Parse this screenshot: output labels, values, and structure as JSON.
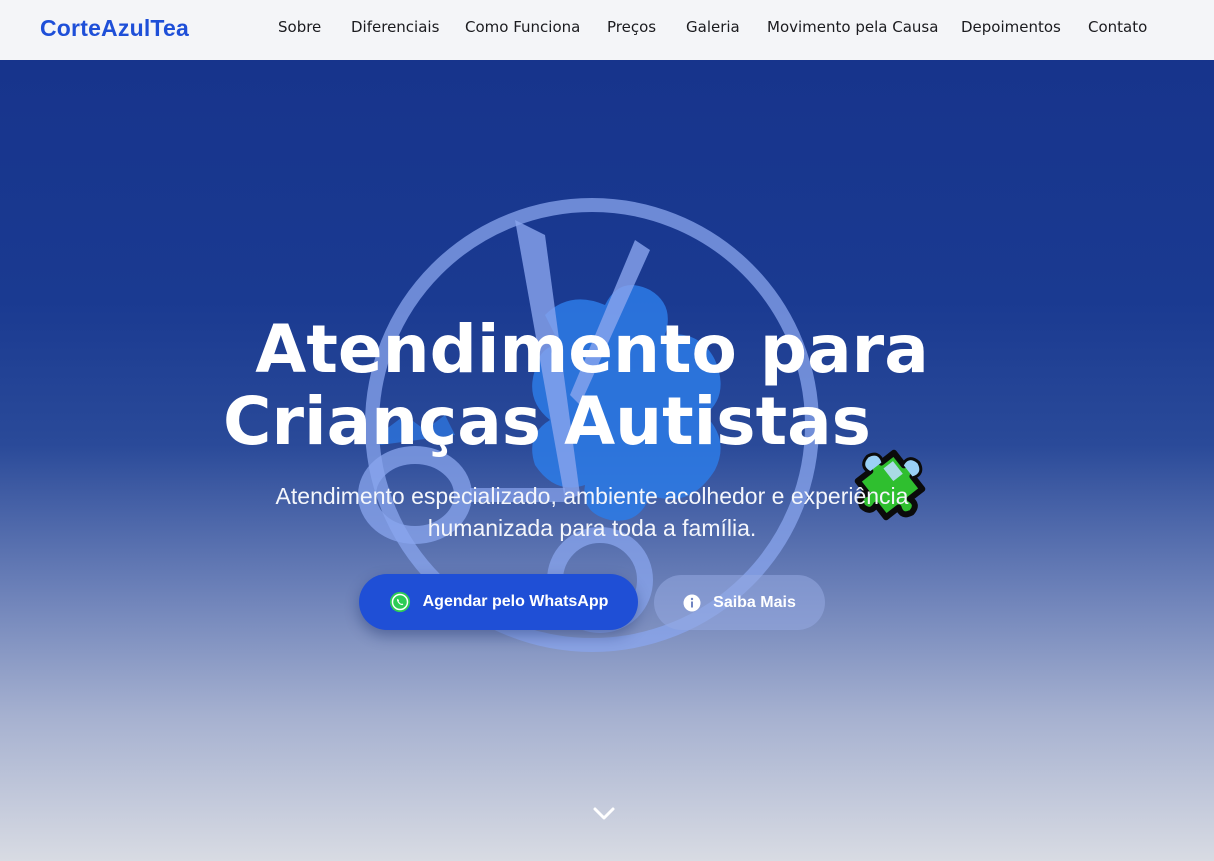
{
  "brand": {
    "name": "CorteAzulTea",
    "color": "#1e4fd8"
  },
  "nav": {
    "items": [
      {
        "label": "Sobre"
      },
      {
        "label": "Diferenciais"
      },
      {
        "label": "Como Funciona"
      },
      {
        "label": "Preços"
      },
      {
        "label": "Galeria"
      },
      {
        "label": "Movimento pela Causa"
      },
      {
        "label": "Depoimentos"
      },
      {
        "label": "Contato"
      }
    ]
  },
  "hero": {
    "title_line1": "Atendimento para",
    "title_line2": "Crianças Autistas",
    "title_icon": "puzzle-piece-icon",
    "subtitle": "Atendimento especializado, ambiente acolhedor e experiência humanizada para toda a família.",
    "primary_button": {
      "label": "Agendar pelo WhatsApp",
      "icon": "whatsapp-icon",
      "color": "#1f4fd6"
    },
    "secondary_button": {
      "label": "Saiba Mais",
      "icon": "info-icon"
    },
    "scroll_icon": "chevron-down-icon",
    "background_top": "#17348c",
    "background_bottom": "#d8dbe3"
  }
}
